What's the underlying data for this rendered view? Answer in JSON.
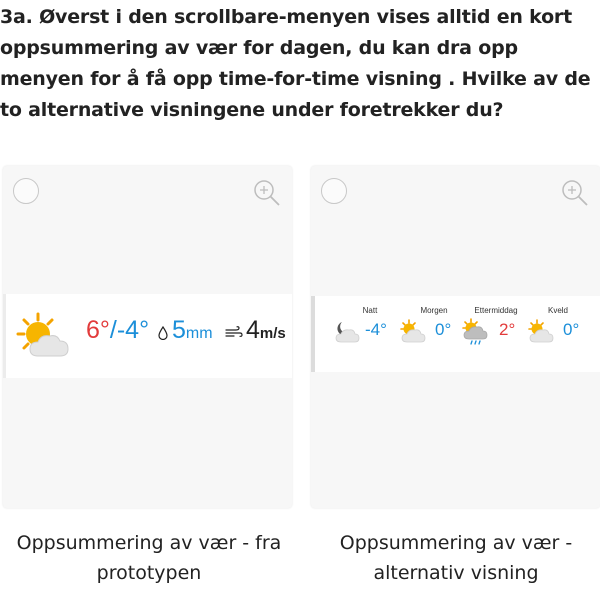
{
  "question": "3a. Øverst i den scrollbare-menyen vises alltid en kort oppsummering av vær for dagen, du kan dra opp menyen for å få opp time-for-time visning . Hvilke av de to alternative visningene under foretrekker du?",
  "option_left": {
    "caption": "Oppsummering av vær - fra prototypen",
    "weather_icon": "partly-cloudy-icon",
    "temp_high": "6°",
    "temp_sep": "/",
    "temp_low": "-4°",
    "precip_value": "5",
    "precip_unit": "mm",
    "wind_value": "4",
    "wind_unit": "m/s",
    "colors": {
      "high": "#e23b3b",
      "low": "#1c8fd9",
      "text": "#222222"
    }
  },
  "option_right": {
    "caption": "Oppsummering av vær - alternativ visning",
    "periods": [
      {
        "label": "Natt",
        "icon": "moon-cloud-icon",
        "temp": "-4°",
        "color": "#1c8fd9"
      },
      {
        "label": "Morgen",
        "icon": "sun-cloud-icon",
        "temp": "0°",
        "color": "#1c8fd9"
      },
      {
        "label": "Ettermiddag",
        "icon": "sun-cloud-rain-icon",
        "temp": "2°",
        "color": "#e23b3b"
      },
      {
        "label": "Kveld",
        "icon": "sun-cloud-icon",
        "temp": "0°",
        "color": "#1c8fd9"
      }
    ]
  }
}
